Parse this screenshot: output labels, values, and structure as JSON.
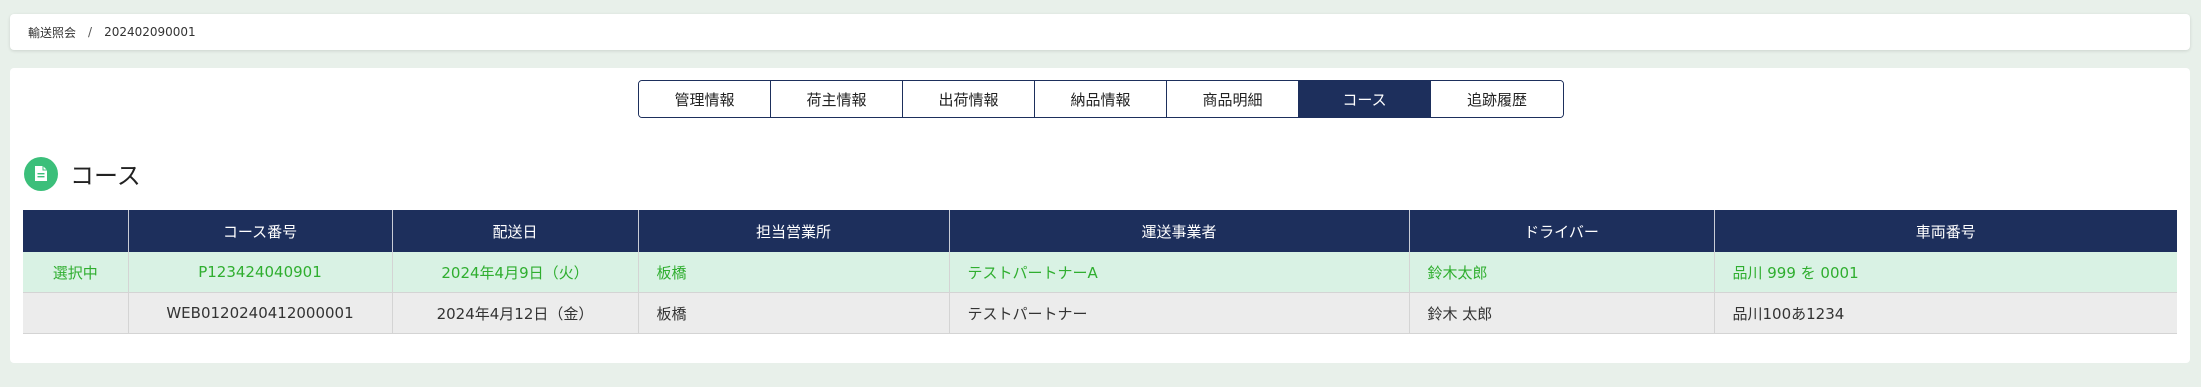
{
  "breadcrumb": {
    "parent": "輸送照会",
    "separator": "/",
    "current": "202402090001"
  },
  "tabs": [
    {
      "label": "管理情報",
      "active": false
    },
    {
      "label": "荷主情報",
      "active": false
    },
    {
      "label": "出荷情報",
      "active": false
    },
    {
      "label": "納品情報",
      "active": false
    },
    {
      "label": "商品明細",
      "active": false
    },
    {
      "label": "コース",
      "active": true
    },
    {
      "label": "追跡履歴",
      "active": false
    }
  ],
  "section": {
    "title": "コース",
    "icon": "document-icon"
  },
  "table": {
    "headers": [
      "",
      "コース番号",
      "配送日",
      "担当営業所",
      "運送事業者",
      "ドライバー",
      "車両番号"
    ],
    "rows": [
      {
        "status": "選択中",
        "course_no": "P123424040901",
        "date": "2024年4月9日（火）",
        "office": "板橋",
        "carrier": "テストパートナーA",
        "driver": "鈴木太郎",
        "vehicle": "品川 999 を 0001"
      },
      {
        "status": "",
        "course_no": "WEB0120240412000001",
        "date": "2024年4月12日（金）",
        "office": "板橋",
        "carrier": "テストパートナー",
        "driver": "鈴木 太郎",
        "vehicle": "品川100あ1234"
      }
    ]
  },
  "colors": {
    "header_navy": "#1d2f5c",
    "accent_green": "#3bbf7a",
    "selected_row_bg": "#d9f2e4",
    "selected_text": "#2fae2f"
  }
}
